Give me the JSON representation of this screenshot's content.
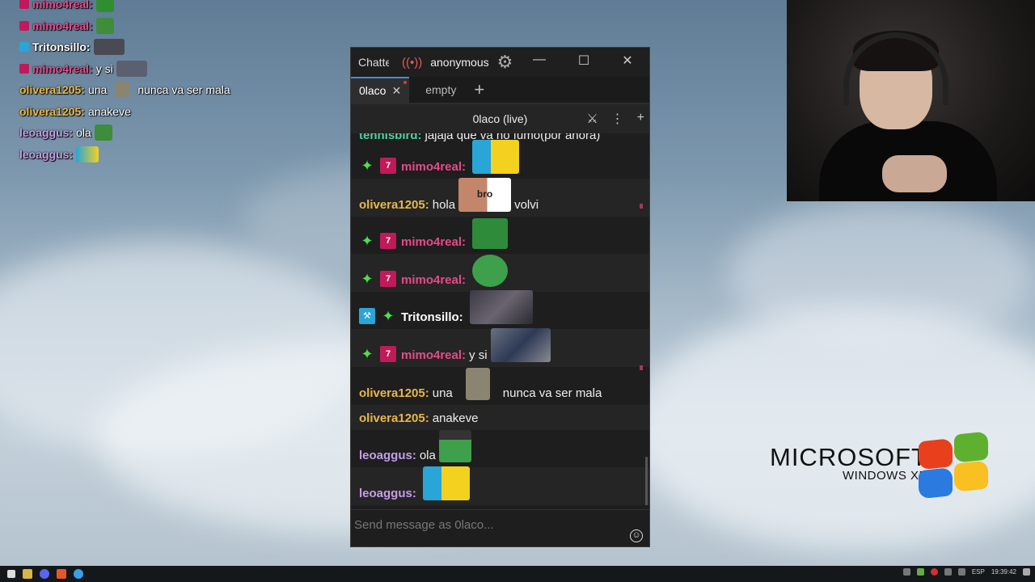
{
  "overlay": {
    "lines": [
      {
        "user": "mimo4real:",
        "text": "",
        "color": "#e64a8c"
      },
      {
        "user": "mimo4real:",
        "text": "",
        "color": "#e64a8c"
      },
      {
        "user": "Tritonsillo:",
        "text": "",
        "color": "#ffffff"
      },
      {
        "user": "mimo4real:",
        "text": "y si",
        "color": "#e64a8c"
      },
      {
        "user": "olivera1205:",
        "text": "una",
        "text2": "nunca va ser mala",
        "color": "#e8b84a"
      },
      {
        "user": "olivera1205:",
        "text": "anakeve",
        "color": "#e8b84a"
      },
      {
        "user": "leoaggus:",
        "text": "ola",
        "color": "#c49ee8"
      },
      {
        "user": "leoaggus:",
        "text": "",
        "color": "#c49ee8"
      }
    ]
  },
  "window": {
    "app_title": "Chatterino",
    "user": "anonymous",
    "tabs": [
      {
        "label": "0laco",
        "active": true
      },
      {
        "label": "empty",
        "active": false
      }
    ],
    "channel_header": "0laco (live)",
    "input_placeholder": "Send message as 0laco..."
  },
  "messages": [
    {
      "user": "tennisbird:",
      "text": "jajaja que va no fumo(por ahora)",
      "color": "#4dd3a0",
      "cut": true
    },
    {
      "user": "mimo4real:",
      "badges": [
        "spark",
        "seven"
      ],
      "text": "",
      "emote": "bird",
      "color": "#e64a8c"
    },
    {
      "user": "olivera1205:",
      "text": "hola",
      "emote": "cat",
      "emote_label": "bro",
      "text2": "volvi",
      "color": "#e8b84a"
    },
    {
      "user": "mimo4real:",
      "badges": [
        "spark",
        "seven"
      ],
      "text": "",
      "emote": "pepe",
      "color": "#e64a8c"
    },
    {
      "user": "mimo4real:",
      "badges": [
        "spark",
        "seven"
      ],
      "text": "",
      "emote": "pepe2",
      "color": "#e64a8c"
    },
    {
      "user": "Tritonsillo:",
      "badges": [
        "mod",
        "spark"
      ],
      "text": "",
      "emote": "photo",
      "color": "#ffffff"
    },
    {
      "user": "mimo4real:",
      "badges": [
        "spark",
        "seven"
      ],
      "text": "y si",
      "emote": "photo2",
      "color": "#e64a8c"
    },
    {
      "user": "olivera1205:",
      "text": "una",
      "emote": "stone",
      "text2": "nunca va ser mala",
      "color": "#e8b84a"
    },
    {
      "user": "olivera1205:",
      "text": "anakeve",
      "color": "#e8b84a"
    },
    {
      "user": "leoaggus:",
      "text": "ola",
      "emote": "pepe3",
      "color": "#c49ee8"
    },
    {
      "user": "leoaggus:",
      "text": "",
      "emote": "bird",
      "color": "#c49ee8"
    }
  ],
  "xp_logo": {
    "title": "MICROSOFT",
    "subtitle": "WINDOWS XP"
  },
  "taskbar": {
    "lang": "ESP",
    "clock": "19:39:42"
  }
}
